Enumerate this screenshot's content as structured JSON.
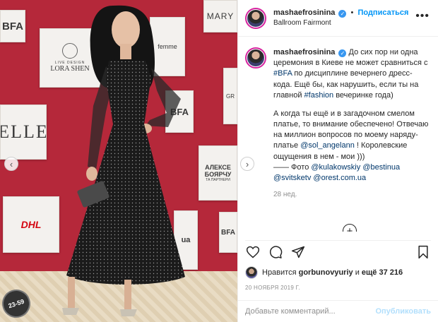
{
  "photo": {
    "panels": {
      "bfa_top": "BFA",
      "mary": "MARY",
      "lora_small": "LIVE DESIGN",
      "lora": "LORA SHEN",
      "femme": "femme",
      "elle": "ELLE",
      "bfa_mid": "BFA",
      "gr": "GR",
      "alex": "АЛЕКСЕ",
      "boyarch": "БОЯРЧУ",
      "partners": "ТА ПАРТНЕРИ",
      "dhl": "DHL",
      "ua": "ua",
      "bfa_low": "BFA"
    },
    "stamp_text": "23-59",
    "prev_arrow": "‹",
    "next_arrow": "›"
  },
  "header": {
    "username": "mashaefrosinina",
    "separator": "•",
    "follow_label": "Подписаться",
    "location": "Ballroom Fairmont",
    "more_label": "•••"
  },
  "caption": {
    "username": "mashaefrosinina",
    "p1_a": "До сих пор ни одна церемония в Киеве не может сравниться с ",
    "p1_tag": "#BFA",
    "p1_b": " по дисциплине вечернего дресс-кода. Ещё бы, как нарушить, если ты на главной ",
    "p1_tag2": "#fashion",
    "p1_c": " вечеринке года)",
    "p2_a": "А когда ты ещё и в загадочном смелом платье, то внимание обеспечено! Отвечаю на миллион вопросов по моему наряду- платье ",
    "p2_mention": "@sol_angelann",
    "p2_b": " ! Королевские ощущения в нем - мои )))",
    "p2_c": "—— Фото ",
    "m1": "@kulakowskiy",
    "m2": "@bestinua",
    "m3": "@svitsketv",
    "m4": "@orest.com.ua",
    "age": "28 нед.",
    "load_more": "+"
  },
  "likes": {
    "prefix": "Нравится",
    "user": "gorbunovyuriy",
    "and": "и",
    "count": "ещё 37 216"
  },
  "date": "20 НОЯБРЯ 2019 Г.",
  "comment": {
    "placeholder": "Добавьте комментарий...",
    "publish_label": "Опубликовать"
  },
  "icons": {
    "heart": "heart-icon",
    "comment": "comment-icon",
    "share": "share-icon",
    "bookmark": "bookmark-icon"
  },
  "colors": {
    "accent_blue": "#0095f6",
    "wall_red": "#b5283a",
    "verified_blue": "#3897f0"
  }
}
